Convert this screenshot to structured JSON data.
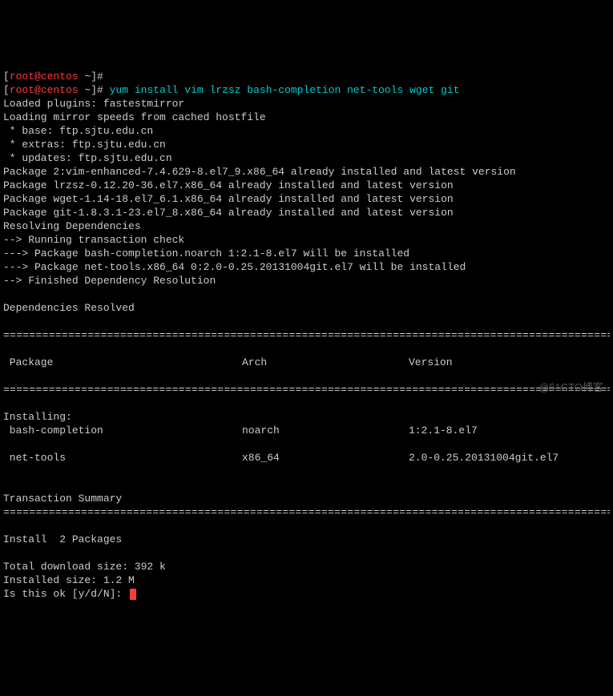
{
  "prompt": {
    "lbracket": "[",
    "user_host": "root@centos",
    "path": " ~",
    "rbracket_hash": "]# ",
    "cmd1": "",
    "cmd2": "yum install vim lrzsz bash-completion net-tools wget git"
  },
  "lines": {
    "l1": "Loaded plugins: fastestmirror",
    "l2": "Loading mirror speeds from cached hostfile",
    "l3": " * base: ftp.sjtu.edu.cn",
    "l4": " * extras: ftp.sjtu.edu.cn",
    "l5": " * updates: ftp.sjtu.edu.cn",
    "l6": "Package 2:vim-enhanced-7.4.629-8.el7_9.x86_64 already installed and latest version",
    "l7": "Package lrzsz-0.12.20-36.el7.x86_64 already installed and latest version",
    "l8": "Package wget-1.14-18.el7_6.1.x86_64 already installed and latest version",
    "l9": "Package git-1.8.3.1-23.el7_8.x86_64 already installed and latest version",
    "l10": "Resolving Dependencies",
    "l11": "--> Running transaction check",
    "l12": "---> Package bash-completion.noarch 1:2.1-8.el7 will be installed",
    "l13": "---> Package net-tools.x86_64 0:2.0-0.25.20131004git.el7 will be installed",
    "l14": "--> Finished Dependency Resolution",
    "blank": "",
    "depres": "Dependencies Resolved",
    "dsep": "===============================================================================================",
    "ssep": "-----------------------------------------------------------------------------------------------"
  },
  "table": {
    "h1": " Package",
    "h2": "Arch",
    "h3": "Version",
    "sect": "Installing:",
    "r1c1": " bash-completion",
    "r1c2": "noarch",
    "r1c3": "1:2.1-8.el7",
    "r2c1": " net-tools",
    "r2c2": "x86_64",
    "r2c3": "2.0-0.25.20131004git.el7"
  },
  "summary": {
    "title": "Transaction Summary",
    "install": "Install  2 Packages",
    "dl": "Total download size: 392 k",
    "isz": "Installed size: 1.2 M",
    "ask": "Is this ok [y/d/N]: "
  },
  "watermark": "@51CTO博客"
}
